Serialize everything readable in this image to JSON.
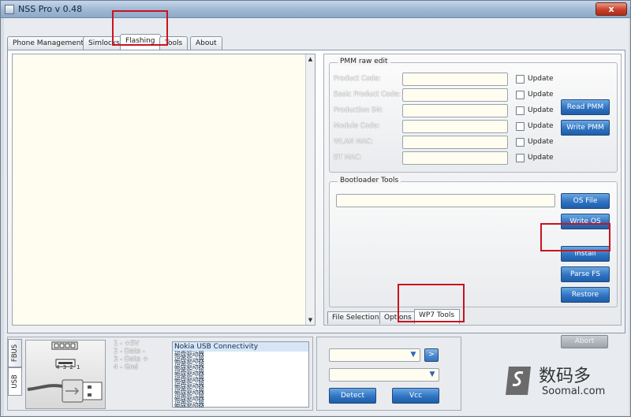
{
  "window": {
    "title": "NSS Pro v 0.48",
    "close_glyph": "x"
  },
  "tabs": [
    "Phone Management",
    "Simlocks",
    "Flashing",
    "Tools",
    "About"
  ],
  "active_tab": "Flashing",
  "pmm": {
    "title": "PMM raw edit",
    "update_label": "Update",
    "fields": [
      "Product Code:",
      "Basic Product Code:",
      "Production SN:",
      "Module Code:",
      "WLAN MAC:",
      "BT MAC:"
    ],
    "read_label": "Read PMM",
    "write_label": "Write PMM"
  },
  "bootloader": {
    "title": "Bootloader Tools",
    "os_file_label": "OS File",
    "write_os_label": "Write OS",
    "install_label": "Install",
    "parse_fs_label": "Parse FS",
    "restore_label": "Restore"
  },
  "subtabs": [
    "File Selection",
    "Options",
    "WP7 Tools"
  ],
  "active_subtab": "WP7 Tools",
  "connection": {
    "tabs": [
      "FBUS",
      "USB"
    ],
    "active": "USB",
    "pin_numbers": "4 3 2 1",
    "pins": [
      "1 - +5V",
      "2 - Data -",
      "3 - Data +",
      "4 - Gnd"
    ],
    "devices": [
      "Nokia USB Connectivity"
    ],
    "garbled_rows": [
      "磁盘驱动器",
      "磁盘驱动器",
      "磁盘驱动器",
      "磁盘驱动器",
      "磁盘驱动器",
      "磁盘驱动器",
      "磁盘驱动器",
      "磁盘驱动器",
      "磁盘驱动器"
    ]
  },
  "actions": {
    "go_glyph": ">",
    "detect_label": "Detect",
    "vcc_label": "Vcc",
    "abort_label": "Abort"
  },
  "watermark": {
    "cn": "数码多",
    "en": "Soomal.com"
  },
  "colors": {
    "accent": "#2f73c2",
    "highlight": "#c8141e",
    "input_bg": "#fffdf0"
  }
}
